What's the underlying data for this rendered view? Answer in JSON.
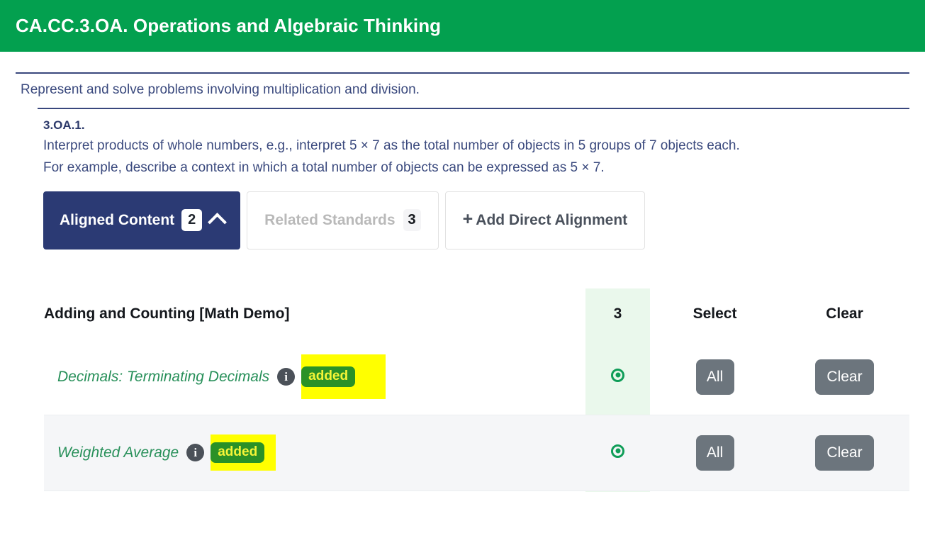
{
  "header": {
    "title": "CA.CC.3.OA. Operations and Algebraic Thinking",
    "background_color": "#03a04f"
  },
  "cluster": {
    "text": "Represent and solve problems involving multiplication and division."
  },
  "standard": {
    "code": "3.OA.1.",
    "description": "Interpret products of whole numbers, e.g., interpret 5 × 7 as the total number of objects in 5 groups of 7 objects each. For example, describe a context in which a total number of objects can be expressed as 5 × 7."
  },
  "tabs": {
    "aligned_content": {
      "label": "Aligned Content",
      "count": "2",
      "chevron": "chevron-up-icon",
      "active": true,
      "color": "#2b3a74"
    },
    "related_standards": {
      "label": "Related Standards",
      "count": "3",
      "active": false
    },
    "add_direct_alignment": {
      "plus": "+",
      "label": "Add Direct Alignment"
    }
  },
  "alignment_table": {
    "columns": {
      "title": "Adding and Counting [Math Demo]",
      "count": "3",
      "select": "Select",
      "clear": "Clear"
    },
    "highlight_column_color": "#eaf8ec",
    "rows": [
      {
        "name": "Decimals: Terminating Decimals",
        "info_icon": "info-icon",
        "badge": "added",
        "badge_highlight_color": "#ffff00",
        "badge_color": "#2a9127",
        "selected": true,
        "select_label": "All",
        "clear_label": "Clear"
      },
      {
        "name": "Weighted Average",
        "info_icon": "info-icon",
        "badge": "added",
        "badge_highlight_color": "#ffff00",
        "badge_color": "#2a9127",
        "selected": true,
        "select_label": "All",
        "clear_label": "Clear"
      }
    ]
  }
}
